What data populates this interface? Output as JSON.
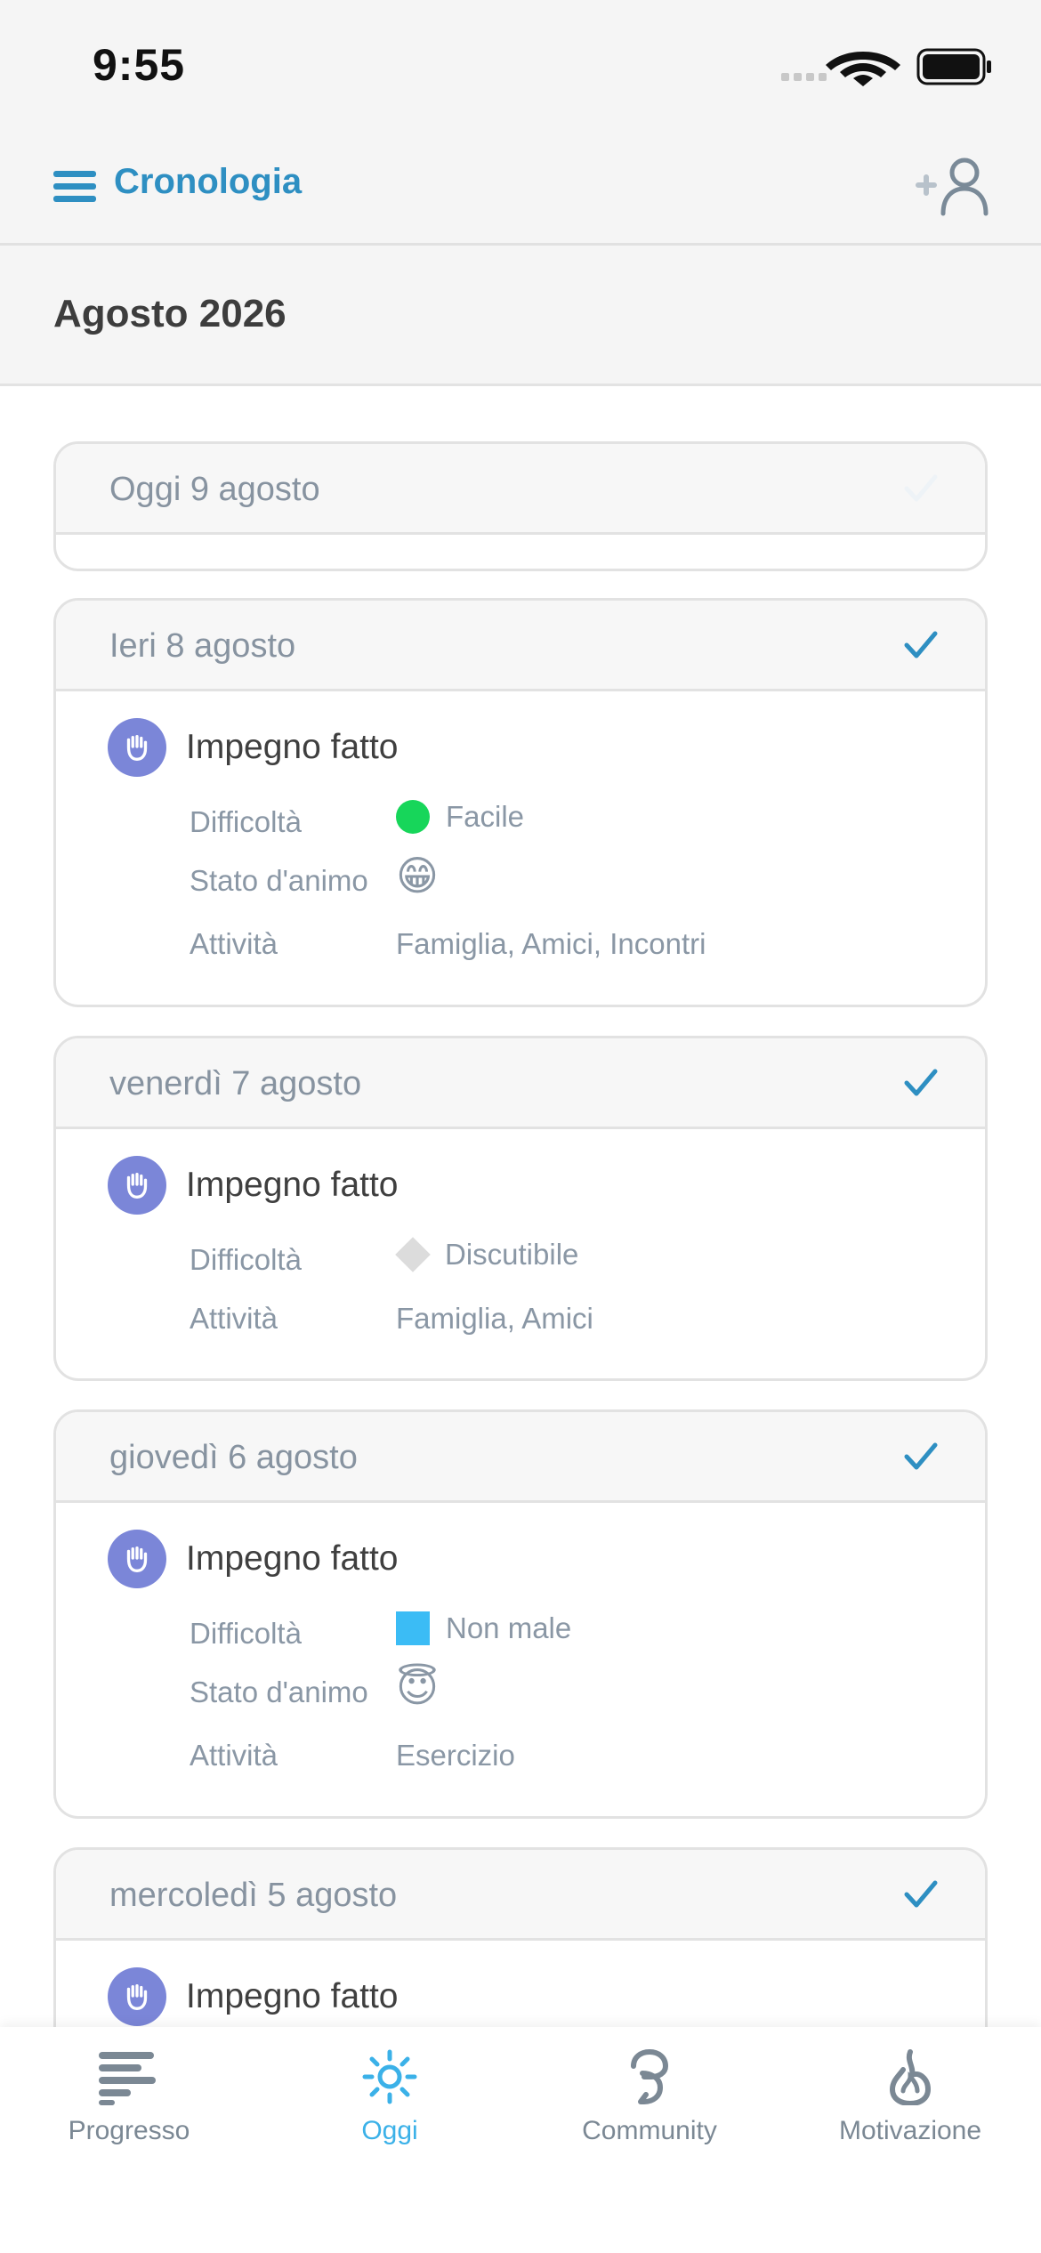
{
  "status_bar": {
    "time": "9:55"
  },
  "header": {
    "title": "Cronologia"
  },
  "month": {
    "title": "Agosto 2026"
  },
  "labels": {
    "difficulty": "Difficoltà",
    "mood": "Stato d'animo",
    "activities": "Attività"
  },
  "days": [
    {
      "label": "Oggi 9 agosto",
      "checked": false,
      "entries": []
    },
    {
      "label": "Ieri 8 agosto",
      "checked": true,
      "entry": {
        "title": "Impegno fatto",
        "difficulty": "Facile",
        "difficulty_color": "#17d65a",
        "mood_emoji": "😁",
        "activities": "Famiglia, Amici, Incontri"
      }
    },
    {
      "label": "venerdì 7 agosto",
      "checked": true,
      "entry": {
        "title": "Impegno fatto",
        "difficulty": "Discutibile",
        "difficulty_color": "#dcdcdc",
        "activities": "Famiglia, Amici"
      }
    },
    {
      "label": "giovedì 6 agosto",
      "checked": true,
      "entry": {
        "title": "Impegno fatto",
        "difficulty": "Non male",
        "difficulty_color": "#3bbcf5",
        "mood_emoji": "😇",
        "activities": "Esercizio"
      }
    },
    {
      "label": "mercoledì 5 agosto",
      "checked": true,
      "entry": {
        "title": "Impegno fatto"
      }
    }
  ],
  "tabs": [
    {
      "label": "Progresso",
      "icon": "progress-icon",
      "active": false
    },
    {
      "label": "Oggi",
      "icon": "sun-icon",
      "active": true
    },
    {
      "label": "Community",
      "icon": "community-icon",
      "active": false
    },
    {
      "label": "Motivazione",
      "icon": "motivation-icon",
      "active": false
    }
  ],
  "colors": {
    "accent": "#2e8fc2",
    "active_tab": "#3bb1e8",
    "entry_icon_bg": "#7b86d8",
    "inactive_tab": "#7b8894"
  }
}
